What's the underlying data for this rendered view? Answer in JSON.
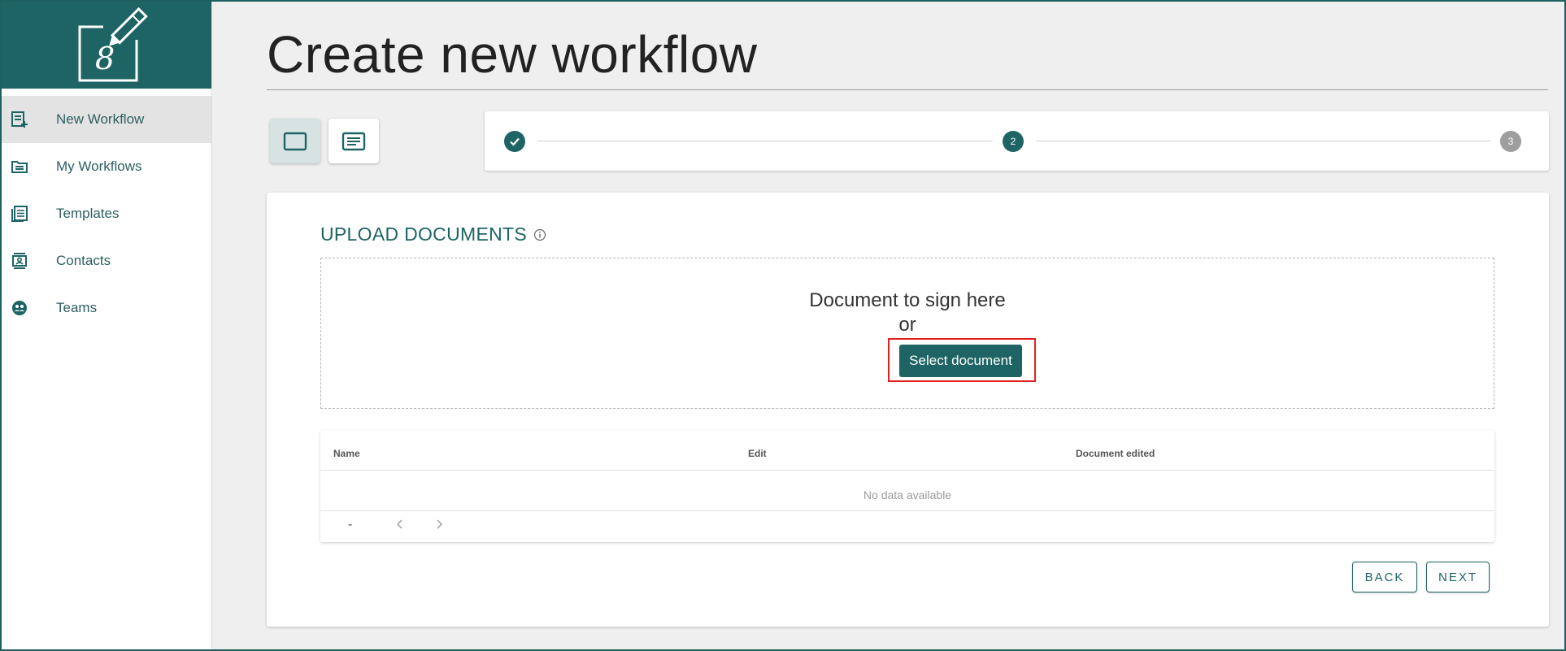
{
  "sidebar": {
    "items": [
      {
        "label": "New Workflow",
        "icon": "new-workflow-icon",
        "active": true
      },
      {
        "label": "My Workflows",
        "icon": "folder-icon",
        "active": false
      },
      {
        "label": "Templates",
        "icon": "templates-icon",
        "active": false
      },
      {
        "label": "Contacts",
        "icon": "contacts-icon",
        "active": false
      },
      {
        "label": "Teams",
        "icon": "teams-icon",
        "active": false
      }
    ]
  },
  "header": {
    "title": "Create new workflow"
  },
  "stepper": {
    "steps": [
      "",
      "2",
      "3"
    ],
    "current_step": 2
  },
  "upload": {
    "heading": "UPLOAD DOCUMENTS",
    "drop_text": "Document to sign here",
    "drop_or": "or",
    "select_button": "Select document"
  },
  "table": {
    "columns": [
      "Name",
      "Edit",
      "Document edited"
    ],
    "empty_text": "No data available",
    "pager_text": "-"
  },
  "actions": {
    "back": "BACK",
    "next": "NEXT"
  },
  "colors": {
    "brand": "#1e6465",
    "highlight": "#e02020"
  }
}
